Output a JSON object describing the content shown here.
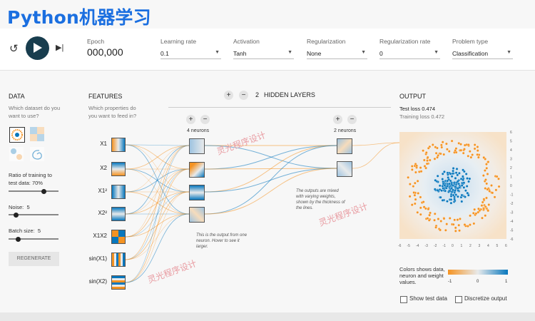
{
  "title": "Python机器学习",
  "controls": {
    "reset_icon": "reset-icon",
    "play_icon": "play-icon",
    "step_icon": "step-forward-icon"
  },
  "epoch": {
    "label": "Epoch",
    "value": "000,000"
  },
  "settings": [
    {
      "label": "Learning rate",
      "value": "0.1"
    },
    {
      "label": "Activation",
      "value": "Tanh"
    },
    {
      "label": "Regularization",
      "value": "None"
    },
    {
      "label": "Regularization rate",
      "value": "0"
    },
    {
      "label": "Problem type",
      "value": "Classification"
    }
  ],
  "data_panel": {
    "heading": "DATA",
    "question": "Which dataset do you want to use?",
    "ratio_label": "Ratio of training to test data:",
    "ratio_value": "70%",
    "ratio_fraction": 0.7,
    "noise_label": "Noise:",
    "noise_value": "5",
    "noise_fraction": 0.1,
    "batch_label": "Batch size:",
    "batch_value": "5",
    "batch_fraction": 0.15,
    "regenerate": "REGENERATE"
  },
  "features": {
    "heading": "FEATURES",
    "question": "Which properties do you want to feed in?",
    "labels": [
      "X1",
      "X2",
      "X1²",
      "X2²",
      "X1X2",
      "sin(X1)",
      "sin(X2)"
    ]
  },
  "network": {
    "hidden_layers_label": "HIDDEN LAYERS",
    "hidden_layers_count": "2",
    "layers": [
      {
        "neurons_label": "4 neurons"
      },
      {
        "neurons_label": "2 neurons"
      }
    ],
    "note_neuron": "This is the output from one neuron. Hover to see it larger.",
    "note_weights": "The outputs are mixed with varying weights, shown by the thickness of the lines."
  },
  "output": {
    "heading": "OUTPUT",
    "test_loss": "Test loss 0.474",
    "training_loss": "Training loss 0.472",
    "x_ticks": [
      "-6",
      "-5",
      "-4",
      "-3",
      "-2",
      "-1",
      "0",
      "1",
      "2",
      "3",
      "4",
      "5",
      "6"
    ],
    "y_ticks": [
      "6",
      "5",
      "4",
      "3",
      "2",
      "1",
      "0",
      "-1",
      "-2",
      "-3",
      "-4",
      "-5",
      "-6"
    ],
    "legend_text": "Colors shows data, neuron and weight values.",
    "legend_ticks": [
      "-1",
      "0",
      "1"
    ],
    "show_test": "Show test data",
    "discretize": "Discretize output"
  },
  "watermark": "灵光程序设计",
  "colors": {
    "accent": "#1b6fe0",
    "orange": "#f59322",
    "blue": "#0877bd",
    "dark": "#183d4e"
  }
}
